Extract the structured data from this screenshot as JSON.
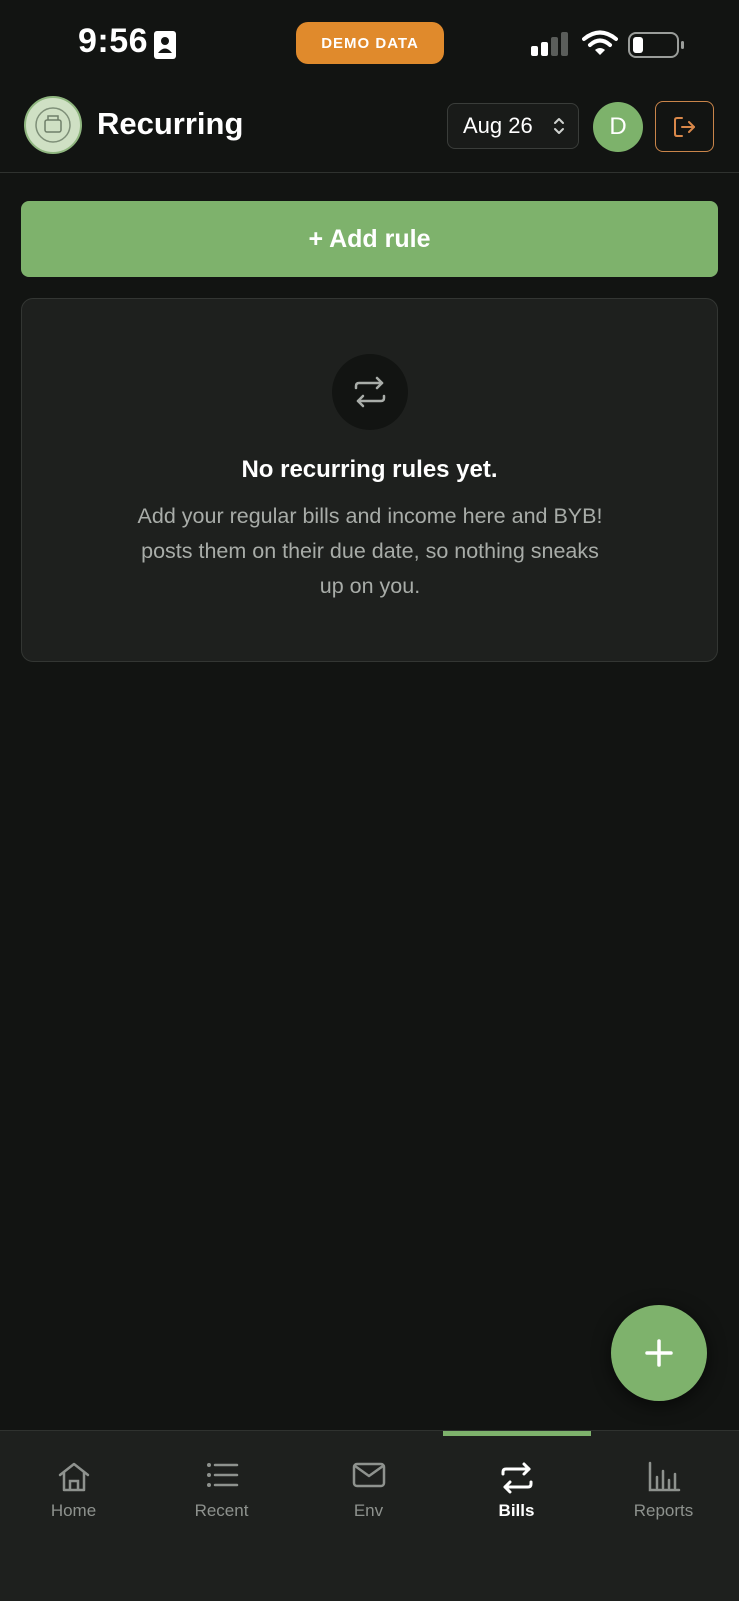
{
  "status_bar": {
    "time": "9:56",
    "demo_badge": "DEMO DATA"
  },
  "header": {
    "title": "Recurring",
    "month_select": "Aug 26",
    "avatar_initial": "D"
  },
  "main": {
    "add_rule_label": "+ Add rule",
    "empty_state": {
      "icon": "repeat-icon",
      "title": "No recurring rules yet.",
      "description": "Add your regular bills and income here and BYB! posts them on their due date, so nothing sneaks up on you."
    }
  },
  "fab": {
    "icon": "plus-icon"
  },
  "bottom_nav": {
    "items": [
      {
        "label": "Home",
        "icon": "home-icon"
      },
      {
        "label": "Recent",
        "icon": "list-icon"
      },
      {
        "label": "Env",
        "icon": "envelope-icon"
      },
      {
        "label": "Bills",
        "icon": "repeat-icon"
      },
      {
        "label": "Reports",
        "icon": "bar-chart-icon"
      }
    ],
    "active": "Bills"
  },
  "colors": {
    "background": "#121412",
    "accent_green": "#7eb26c",
    "demo_orange": "#e08a2c",
    "card": "#1e201e",
    "muted_text": "#a8aca8"
  }
}
